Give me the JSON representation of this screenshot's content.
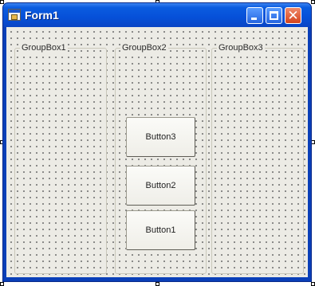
{
  "window": {
    "title": "Form1",
    "icon": "form-icon",
    "caption_buttons": {
      "minimize": "minimize-icon",
      "maximize": "maximize-icon",
      "close": "close-icon",
      "close_glyph": "✕"
    }
  },
  "client": {
    "group_boxes": [
      {
        "label": "GroupBox1"
      },
      {
        "label": "GroupBox2",
        "buttons": [
          "Button3",
          "Button2",
          "Button1"
        ]
      },
      {
        "label": "GroupBox3"
      }
    ]
  },
  "colors": {
    "titlebar": "#0650d8",
    "client_background": "#ecebe5",
    "close_button": "#d4431c"
  }
}
